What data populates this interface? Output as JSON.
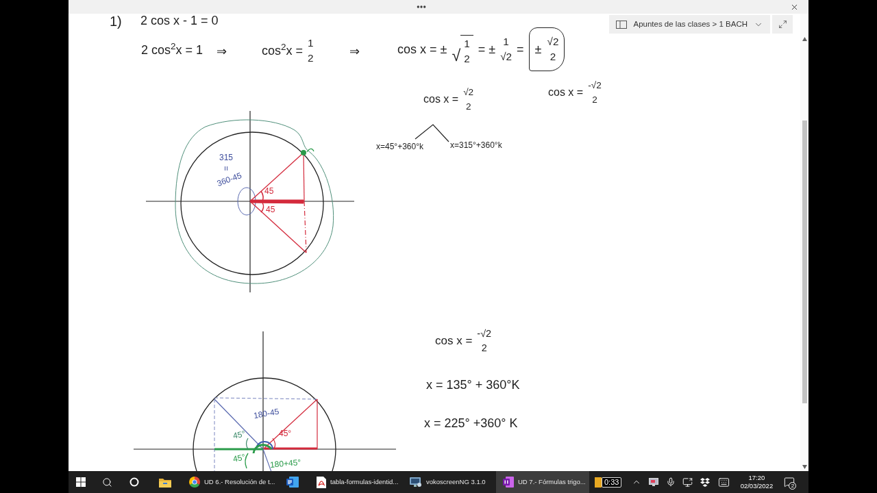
{
  "breadcrumb": {
    "path": "Apuntes de las clases > 1 BACH"
  },
  "note": {
    "ink": [
      {
        "tokens": [
          {
            "kind": "text",
            "text": "1)"
          }
        ]
      },
      {
        "tokens": [
          {
            "kind": "text",
            "text": "2 cos x - 1 = 0"
          }
        ]
      },
      {
        "tokens": [
          {
            "kind": "text",
            "text": "2 cos$^{2}$x = 1"
          }
        ]
      },
      {
        "tokens": [
          {
            "kind": "text",
            "text": "⇒"
          }
        ]
      },
      {
        "tokens": [
          {
            "kind": "text",
            "text": "cos$^{2}$x ="
          },
          {
            "kind": "fraction",
            "numerator": "1",
            "denominator": "2"
          }
        ]
      },
      {
        "tokens": [
          {
            "kind": "text",
            "text": "⇒"
          }
        ]
      },
      {
        "tokens": [
          {
            "kind": "text",
            "text": "cos x = ±"
          },
          {
            "kind": "root",
            "sign": "√",
            "numerator": "1",
            "denominator": "2"
          },
          {
            "kind": "text",
            "text": "= ±"
          },
          {
            "kind": "fraction",
            "numerator": "1",
            "denominator": "√2"
          },
          {
            "kind": "text",
            "text": "="
          },
          {
            "kind": "boxed",
            "tokens": [
              {
                "kind": "text",
                "text": "±"
              },
              {
                "kind": "fraction",
                "numerator": "√2",
                "denominator": "2"
              }
            ]
          }
        ]
      },
      {
        "tokens": [
          {
            "kind": "text",
            "text": "cos x ="
          },
          {
            "kind": "fraction",
            "numerator": "√2",
            "denominator": "2"
          }
        ]
      },
      {
        "tokens": [
          {
            "kind": "text",
            "text": "cos x ="
          },
          {
            "kind": "fraction",
            "numerator": "-√2",
            "denominator": "2"
          }
        ]
      },
      {
        "tokens": [
          {
            "kind": "text",
            "text": "x=45°+360°k"
          }
        ]
      },
      {
        "tokens": [
          {
            "kind": "text",
            "text": "x=315°+360°k"
          }
        ]
      },
      {
        "tokens": [
          {
            "kind": "text",
            "text": "cos x ="
          },
          {
            "kind": "fraction",
            "numerator": "-√2",
            "denominator": "2"
          }
        ]
      },
      {
        "tokens": [
          {
            "kind": "text",
            "text": "x = 135°  + 360°K"
          }
        ]
      },
      {
        "tokens": [
          {
            "kind": "text",
            "text": "x = 225°  +360° K"
          }
        ]
      }
    ],
    "diagrams": [
      {
        "labels": [
          {
            "text": "315",
            "color": "#3d4d9c"
          },
          {
            "text": "=",
            "color": "#3d4d9c"
          },
          {
            "text": "360-45",
            "color": "#3d4d9c"
          },
          {
            "text": "45",
            "color": "#d42a3c"
          },
          {
            "text": "45",
            "color": "#d42a3c"
          }
        ]
      },
      {
        "labels": [
          {
            "text": "180-45",
            "color": "#3d4d9c"
          },
          {
            "text": "45°",
            "color": "#d42a3c"
          },
          {
            "text": "45°",
            "color": "#3c8a6a"
          },
          {
            "text": "45°",
            "color": "#2a9b4a"
          },
          {
            "text": "180+45°",
            "color": "#2a9b4a"
          }
        ]
      }
    ]
  },
  "taskbar": {
    "apps": [
      {
        "selected": false
      },
      {
        "label": "UD 6.- Resolución de t...",
        "selected": false
      },
      {
        "selected": false
      },
      {
        "label": "tabla-formulas-identid...",
        "selected": false
      },
      {
        "label": "vokoscreenNG 3.1.0",
        "selected": false
      },
      {
        "label": "UD 7.- Fórmulas trigo...",
        "selected": true
      }
    ],
    "recorder_timer": "0:33",
    "time": "17:20",
    "date": "02/03/2022",
    "notification_count": "2"
  }
}
